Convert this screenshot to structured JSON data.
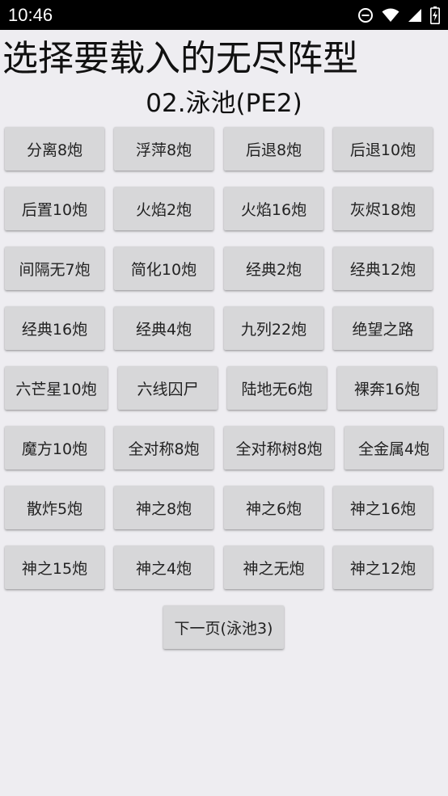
{
  "status_bar": {
    "time": "10:46",
    "icons": [
      "do-not-disturb-icon",
      "wifi-icon",
      "signal-icon",
      "battery-charging-icon"
    ]
  },
  "page": {
    "title": "选择要载入的无尽阵型",
    "subtitle": "02.泳池(PE2)"
  },
  "buttons": [
    [
      "分离8炮",
      "浮萍8炮",
      "后退8炮",
      "后退10炮"
    ],
    [
      "后置10炮",
      "火焰2炮",
      "火焰16炮",
      "灰烬18炮"
    ],
    [
      "间隔无7炮",
      "简化10炮",
      "经典2炮",
      "经典12炮"
    ],
    [
      "经典16炮",
      "经典4炮",
      "九列22炮",
      "绝望之路"
    ],
    [
      "六芒星10炮",
      "六线囚尸",
      "陆地无6炮",
      "裸奔16炮"
    ],
    [
      "魔方10炮",
      "全对称8炮",
      "全对称树8炮",
      "全金属4炮"
    ],
    [
      "散炸5炮",
      "神之8炮",
      "神之6炮",
      "神之16炮"
    ],
    [
      "神之15炮",
      "神之4炮",
      "神之无炮",
      "神之12炮"
    ]
  ],
  "next_page_label": "下一页(泳池3)"
}
